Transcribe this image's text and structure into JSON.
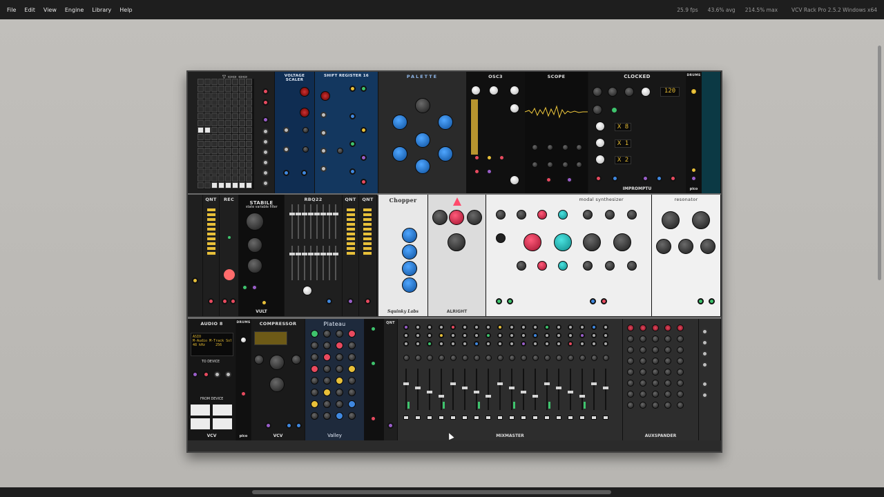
{
  "menu": {
    "file": "File",
    "edit": "Edit",
    "view": "View",
    "engine": "Engine",
    "library": "Library",
    "help": "Help"
  },
  "status": {
    "fps": "25.9 fps",
    "avg": "43.6% avg",
    "max": "214.5% max",
    "version": "VCV Rack Pro 2.5.2 Windows x64"
  },
  "modules": {
    "voltage_scaler": "VOLTAGE SCALER",
    "shift_register": "SHIFT REGISTER 16",
    "palette": "PALETTE",
    "osc3": "OSC3",
    "scope": "SCOPE",
    "clocked": "CLOCKED",
    "clocked_bpm": "120",
    "clocked_r1": "X 8",
    "clocked_r2": "X 1",
    "clocked_r3": "X 2",
    "impromptu": "IMPROMPTU",
    "drums": "DRUMS",
    "pico": "pico",
    "qnt": "QNT",
    "rec": "REC",
    "stabile": "STABILE",
    "stabile_sub": "state variable filter",
    "vult": "VULT",
    "rbq22": "RBQ22",
    "chopper": "Chopper",
    "chopper_brand": "Squinky Labs",
    "modal_synth": "modal synthesizer",
    "resonator": "resonator",
    "audio8": "AUDIO 8",
    "audio_device": "ASIO",
    "audio_driver": "M-Audio M-Track Solo and",
    "audio_rate": "48 kHz",
    "audio_block": "256",
    "compressor": "COMPRESSOR",
    "plateau": "Plateau",
    "valley": "Valley",
    "mixmaster": "MIXMASTER",
    "auxspander": "AUXSPANDER",
    "vcv": "VCV",
    "alright": "ALRIGHT",
    "to_device": "TO DEVICE",
    "from_device": "FROM DEVICE"
  }
}
